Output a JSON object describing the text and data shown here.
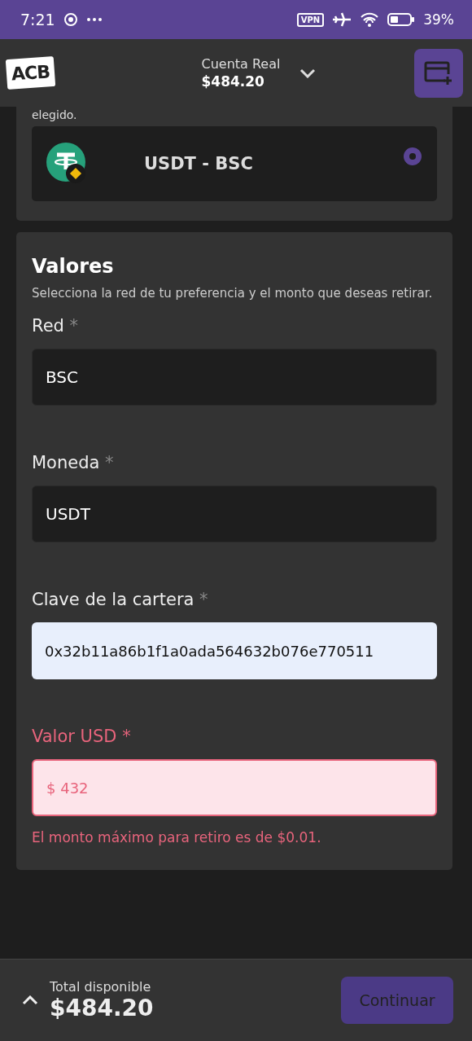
{
  "status_bar": {
    "time": "7:21",
    "battery": "39%",
    "vpn": "VPN"
  },
  "header": {
    "logo": "ACB",
    "account": "Cuenta Real",
    "balance": "$484.20"
  },
  "method_card": {
    "intro_tail": "elegido.",
    "option": {
      "label": "USDT - BSC",
      "selected": true
    }
  },
  "values_card": {
    "title": "Valores",
    "description": "Selecciona la red de tu preferencia y el monto que deseas retirar.",
    "fields": [
      {
        "label": "Red",
        "required": "*",
        "value": "BSC",
        "kind": "dark",
        "error": false
      },
      {
        "label": "Moneda",
        "required": "*",
        "value": "USDT",
        "kind": "dark",
        "error": false
      },
      {
        "label": "Clave de la cartera",
        "required": "*",
        "value": "0x32b11a86b1f1a0ada564632b076e770511",
        "kind": "light",
        "error": false
      },
      {
        "label": "Valor USD",
        "required": "*",
        "value": "$ 432",
        "kind": "light",
        "error": true,
        "message": "El monto máximo para retiro es de $0.01."
      }
    ]
  },
  "footer": {
    "label": "Total disponible",
    "amount": "$484.20",
    "button": "Continuar",
    "button_disabled": true
  }
}
